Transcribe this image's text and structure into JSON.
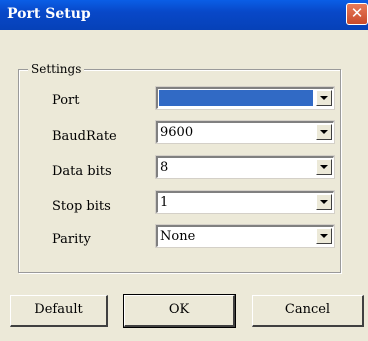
{
  "window": {
    "title": "Port Setup",
    "close_glyph": "✕"
  },
  "settings": {
    "legend": "Settings",
    "fields": [
      {
        "label": "Port",
        "value": ""
      },
      {
        "label": "BaudRate",
        "value": "9600"
      },
      {
        "label": "Data bits",
        "value": "8"
      },
      {
        "label": "Stop bits",
        "value": "1"
      },
      {
        "label": "Parity",
        "value": "None"
      }
    ]
  },
  "buttons": {
    "default": "Default",
    "ok": "OK",
    "cancel": "Cancel"
  },
  "colors": {
    "titlebar": "#0a5ee6",
    "close": "#d55b3a",
    "selection": "#316ac5",
    "dialog_bg": "#ece9d8"
  }
}
